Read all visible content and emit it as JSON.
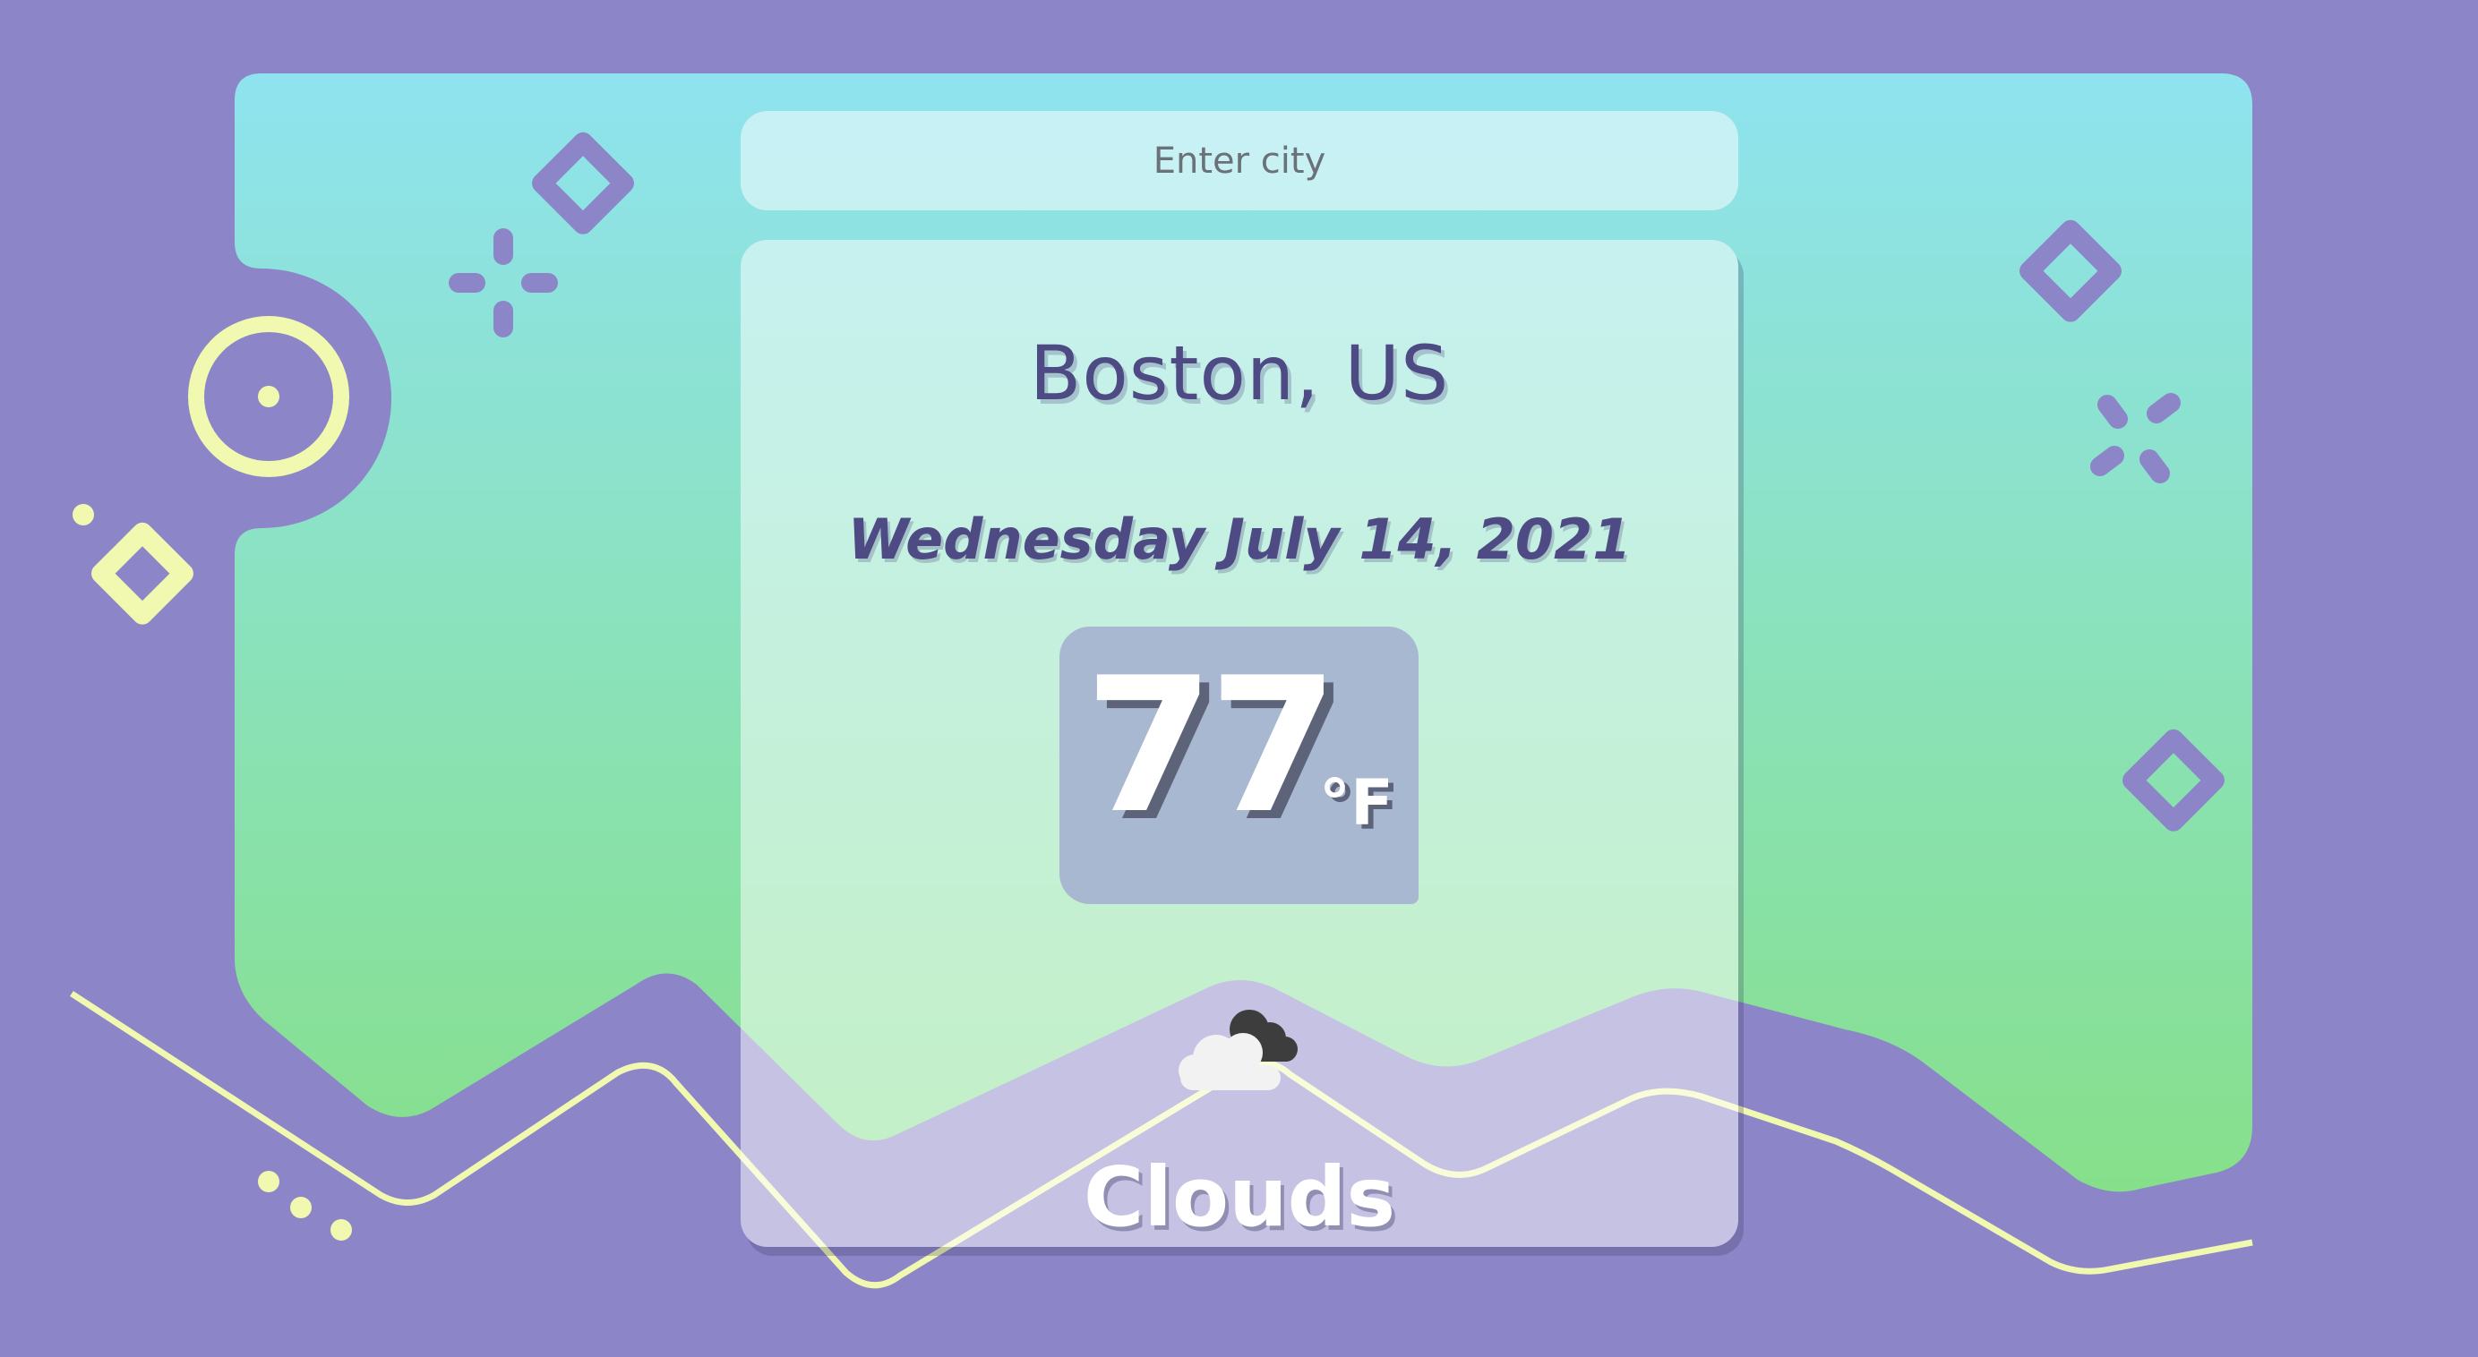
{
  "search": {
    "placeholder": "Enter city"
  },
  "weather": {
    "location": "Boston, US",
    "date": "Wednesday July 14, 2021",
    "temperature": "77",
    "unit": "°F",
    "condition": "Clouds",
    "icon": "clouds-icon"
  },
  "colors": {
    "background": "#8c85c7",
    "panel_gradient_top": "#8fe3ef",
    "panel_gradient_bottom": "#86e08a",
    "accent_purple": "#8c85c7",
    "accent_yellow": "#f1f9b0",
    "text_purple": "#4e4a83",
    "temp_box": "#a9b8d1"
  }
}
